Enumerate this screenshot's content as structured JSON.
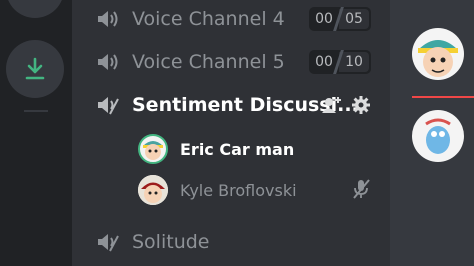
{
  "voice_channels": [
    {
      "name": "Voice Channel 4",
      "current": "00",
      "limit": "05"
    },
    {
      "name": "Voice Channel 5",
      "current": "00",
      "limit": "10"
    }
  ],
  "active_channel": {
    "name": "Sentiment Discussi...",
    "members": [
      {
        "name": "Eric Car man",
        "speaking": true
      },
      {
        "name": "Kyle Broflovski",
        "muted": true
      }
    ]
  },
  "other_channel": {
    "name": "Solitude"
  },
  "colors": {
    "accent_green": "#43b581",
    "muted_red": "#f04747",
    "background": "#2f3136",
    "rail": "#202225"
  },
  "icons": {
    "download": "download-icon",
    "speaker": "speaker-icon",
    "speaker_muted": "speaker-muted-icon",
    "add_user": "add-user-icon",
    "settings": "gear-icon",
    "mic_muted": "mic-muted-icon"
  }
}
